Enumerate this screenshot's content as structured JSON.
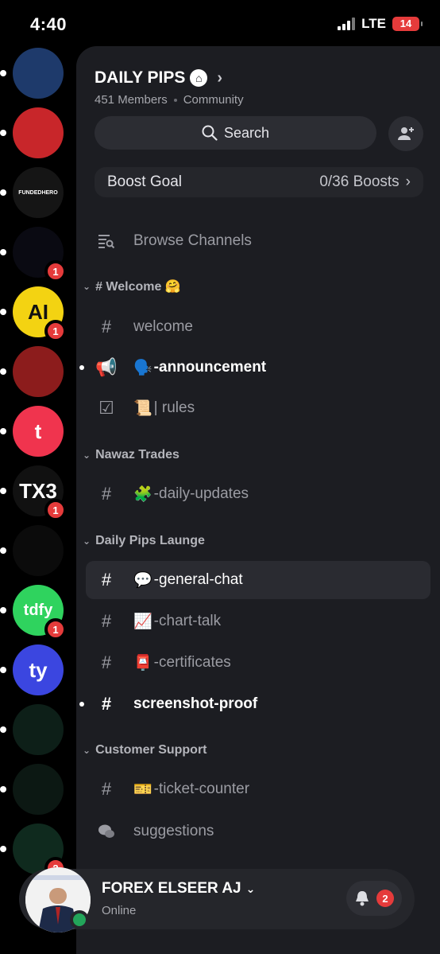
{
  "status_bar": {
    "time": "4:40",
    "network": "LTE",
    "battery": "14"
  },
  "servers": [
    {
      "name": "server-1",
      "color": "#1e3a6b",
      "badge": ""
    },
    {
      "name": "server-2",
      "color": "#c8262a",
      "badge": ""
    },
    {
      "name": "server-fundedhero",
      "color": "#151515",
      "badge": "",
      "text": "FUNDEDHERO"
    },
    {
      "name": "server-4",
      "color": "#0a0a12",
      "badge": "1"
    },
    {
      "name": "server-ai",
      "color": "#f3d312",
      "badge": "1",
      "text": "AI"
    },
    {
      "name": "server-6",
      "color": "#8c1c1c",
      "badge": ""
    },
    {
      "name": "server-t",
      "color": "#f0344e",
      "badge": "",
      "text": "t"
    },
    {
      "name": "server-tx3",
      "color": "#111",
      "badge": "1",
      "text": "TX3"
    },
    {
      "name": "server-9",
      "color": "#0b0b0b",
      "badge": ""
    },
    {
      "name": "server-tdfy",
      "color": "#2fd35e",
      "badge": "1",
      "text": "tdfy"
    },
    {
      "name": "server-ty",
      "color": "#3b46e0",
      "badge": "",
      "text": "ty"
    },
    {
      "name": "server-12",
      "color": "#0d1f18",
      "badge": ""
    },
    {
      "name": "server-13",
      "color": "#0c1813",
      "badge": ""
    },
    {
      "name": "server-14",
      "color": "#0f2a1e",
      "badge": "2"
    }
  ],
  "server": {
    "name": "DAILY PIPS",
    "members": "451 Members",
    "type": "Community"
  },
  "search": {
    "label": "Search"
  },
  "boost": {
    "label": "Boost Goal",
    "value": "0/36 Boosts"
  },
  "browse": {
    "label": "Browse Channels"
  },
  "categories": [
    {
      "label": "# Welcome 🤗"
    },
    {
      "label": "Nawaz Trades"
    },
    {
      "label": "Daily Pips Launge"
    },
    {
      "label": "Customer Support"
    }
  ],
  "channels": [
    {
      "label": "welcome"
    },
    {
      "label": "-announcement",
      "emoji": "🗣️"
    },
    {
      "label": "| rules",
      "emoji": "📜"
    },
    {
      "label": "-daily-updates",
      "emoji": "🧩"
    },
    {
      "label": "-general-chat",
      "emoji": "💬"
    },
    {
      "label": "-chart-talk",
      "emoji": "📈"
    },
    {
      "label": "-certificates",
      "emoji": "📮"
    },
    {
      "label": "screenshot-proof"
    },
    {
      "label": "-ticket-counter",
      "emoji": "🎫"
    },
    {
      "label": "suggestions"
    }
  ],
  "user": {
    "name": "FOREX ELSEER AJ",
    "status": "Online",
    "notifications": "2"
  }
}
